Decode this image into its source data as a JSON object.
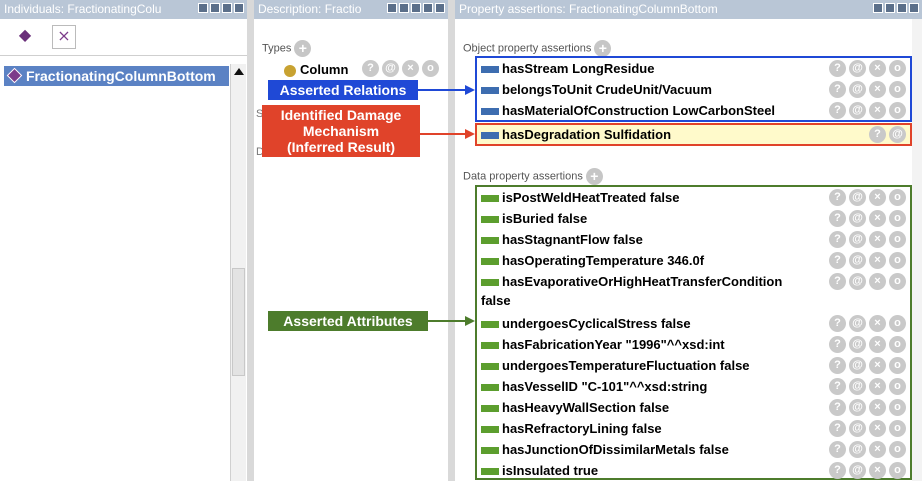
{
  "individuals": {
    "title": "Individuals: FractionatingColu",
    "item_label": "FractionatingColumnBottom"
  },
  "description": {
    "title": "Description: Fractio",
    "types_label": "Types",
    "type_value": "Column",
    "hidden_s": "S",
    "hidden_d": "D"
  },
  "properties": {
    "title": "Property assertions: FractionatingColumnBottom",
    "object_label": "Object property assertions",
    "data_label": "Data property assertions",
    "object_rows": [
      {
        "text": "hasStream  LongResidue"
      },
      {
        "text": "belongsToUnit  CrudeUnit/Vacuum"
      },
      {
        "text": "hasMaterialOfConstruction  LowCarbonSteel"
      }
    ],
    "inferred_row": {
      "text": "hasDegradation  Sulfidation"
    },
    "data_rows": [
      {
        "text": "isPostWeldHeatTreated  false"
      },
      {
        "text": "isBuried  false"
      },
      {
        "text": "hasStagnantFlow  false"
      },
      {
        "text": "hasOperatingTemperature  346.0f"
      },
      {
        "text": "hasEvaporativeOrHighHeatTransferCondition",
        "text2": "false"
      },
      {
        "text": "undergoesCyclicalStress  false"
      },
      {
        "text": "hasFabricationYear  \"1996\"^^xsd:int"
      },
      {
        "text": "undergoesTemperatureFluctuation  false"
      },
      {
        "text": "hasVesselID  \"C-101\"^^xsd:string"
      },
      {
        "text": "hasHeavyWallSection  false"
      },
      {
        "text": "hasRefractoryLining  false"
      },
      {
        "text": "hasJunctionOfDissimilarMetals  false"
      },
      {
        "text": "isInsulated  true"
      }
    ]
  },
  "callouts": {
    "relations": "Asserted Relations",
    "damage_line1": "Identified Damage",
    "damage_line2": "Mechanism",
    "damage_line3": "(Inferred Result)",
    "attributes": "Asserted Attributes"
  },
  "icons": {
    "action_q": "?",
    "action_at": "@",
    "action_x": "×",
    "action_o": "o",
    "plus": "+",
    "add_individual": "◆",
    "delete_individual": "⨯"
  },
  "colors": {
    "title_bar": "#b9c6d6",
    "selection": "#5b82c4",
    "relations_blue": "#1f49d6",
    "damage_red": "#e0432a",
    "attributes_green": "#4d7c2c",
    "object_swatch": "#3d6db0",
    "data_swatch": "#5c9e2e"
  }
}
